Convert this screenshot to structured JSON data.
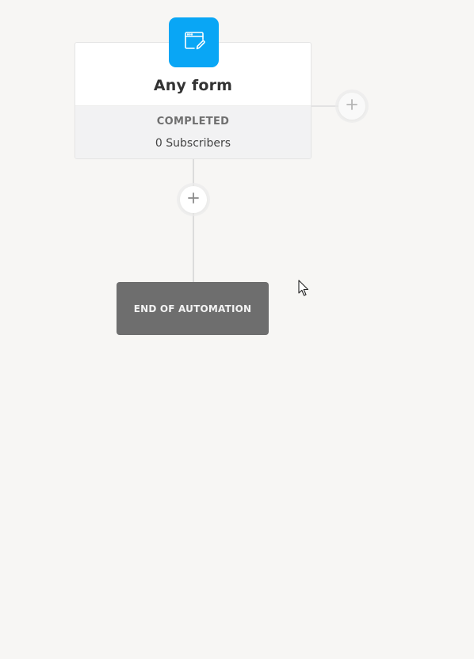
{
  "trigger": {
    "title": "Any form",
    "status": "COMPLETED",
    "subscribers": "0 Subscribers",
    "icon": "form-edit-icon",
    "accent_color": "#09a6f5"
  },
  "add_step_right": {
    "icon": "plus-icon"
  },
  "add_step_below": {
    "icon": "plus-icon"
  },
  "end": {
    "label": "END OF AUTOMATION",
    "color": "#6e6e6e"
  }
}
